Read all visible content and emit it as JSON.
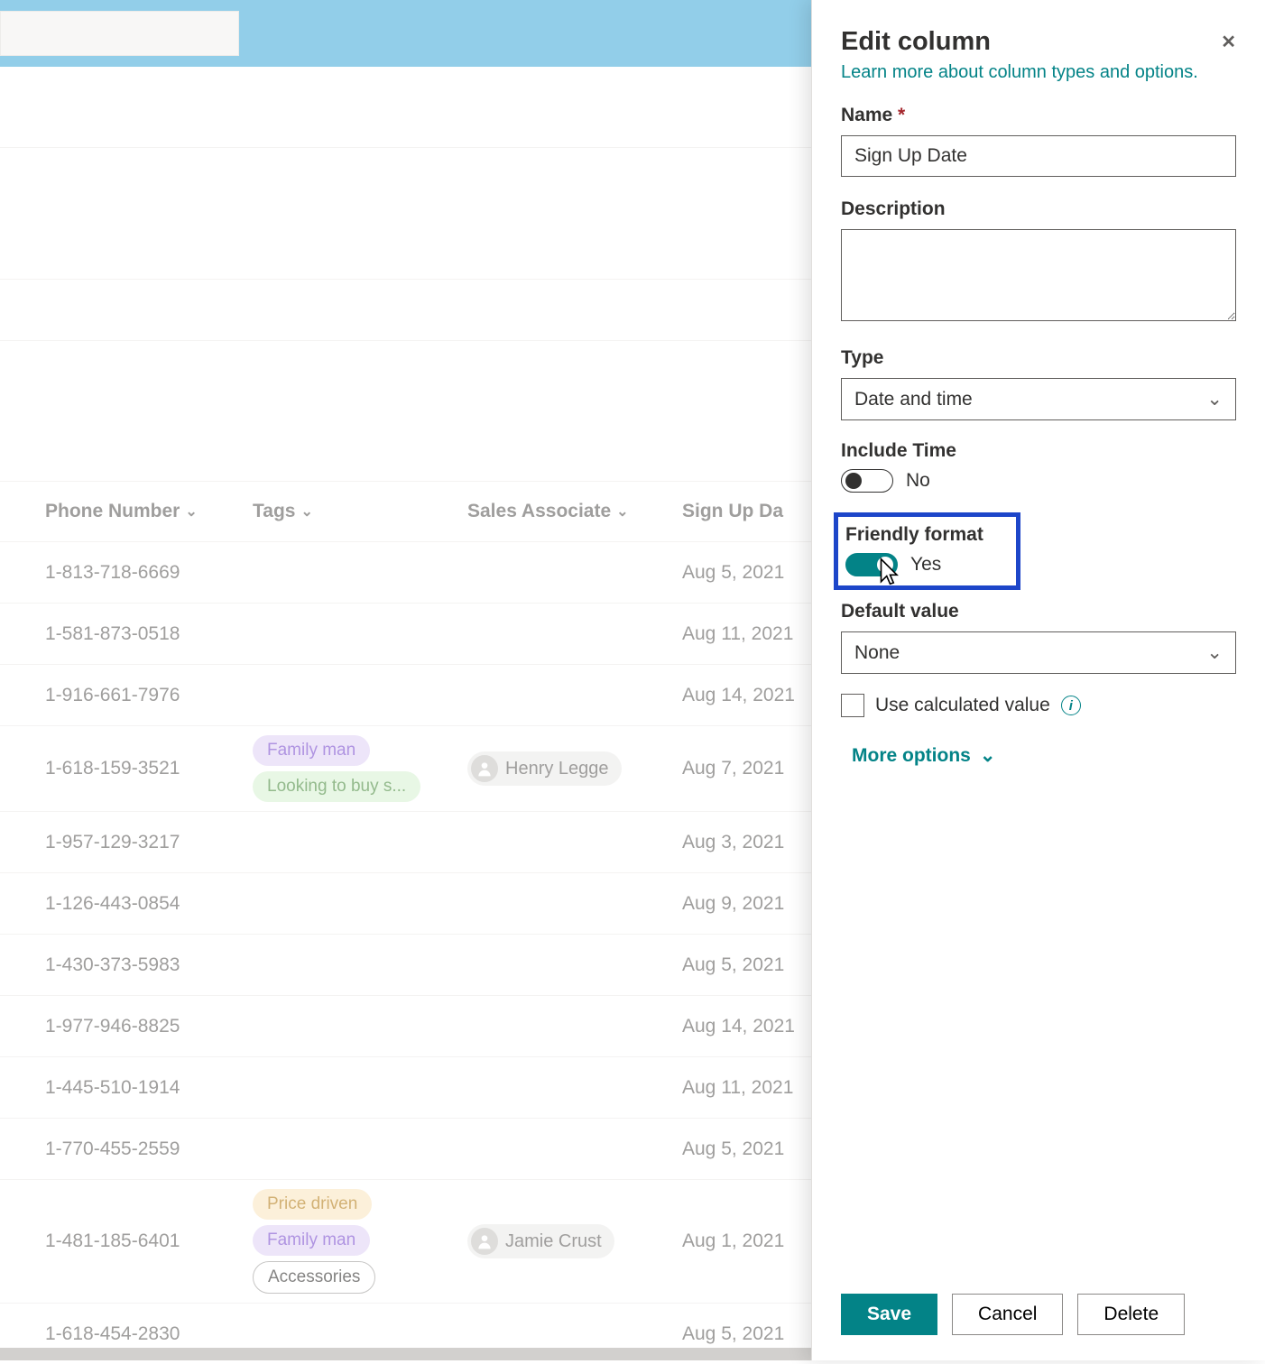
{
  "header": {
    "columns": {
      "phone": "Phone Number",
      "tags": "Tags",
      "sales": "Sales Associate",
      "date": "Sign Up Da"
    }
  },
  "rows": [
    {
      "phone": "1-813-718-6669",
      "tags": [],
      "sales": null,
      "date": "Aug 5, 2021"
    },
    {
      "phone": "1-581-873-0518",
      "tags": [],
      "sales": null,
      "date": "Aug 11, 2021"
    },
    {
      "phone": "1-916-661-7976",
      "tags": [],
      "sales": null,
      "date": "Aug 14, 2021"
    },
    {
      "phone": "1-618-159-3521",
      "tags": [
        {
          "text": "Family man",
          "style": "tag-purple"
        },
        {
          "text": "Looking to buy s...",
          "style": "tag-green"
        }
      ],
      "sales": "Henry Legge",
      "date": "Aug 7, 2021"
    },
    {
      "phone": "1-957-129-3217",
      "tags": [],
      "sales": null,
      "date": "Aug 3, 2021"
    },
    {
      "phone": "1-126-443-0854",
      "tags": [],
      "sales": null,
      "date": "Aug 9, 2021"
    },
    {
      "phone": "1-430-373-5983",
      "tags": [],
      "sales": null,
      "date": "Aug 5, 2021"
    },
    {
      "phone": "1-977-946-8825",
      "tags": [],
      "sales": null,
      "date": "Aug 14, 2021"
    },
    {
      "phone": "1-445-510-1914",
      "tags": [],
      "sales": null,
      "date": "Aug 11, 2021"
    },
    {
      "phone": "1-770-455-2559",
      "tags": [],
      "sales": null,
      "date": "Aug 5, 2021"
    },
    {
      "phone": "1-481-185-6401",
      "tags": [
        {
          "text": "Price driven",
          "style": "tag-orange"
        },
        {
          "text": "Family man",
          "style": "tag-purple"
        },
        {
          "text": "Accessories",
          "style": "tag-outline"
        }
      ],
      "sales": "Jamie Crust",
      "date": "Aug 1, 2021"
    },
    {
      "phone": "1-618-454-2830",
      "tags": [],
      "sales": null,
      "date": "Aug 5, 2021"
    }
  ],
  "panel": {
    "title": "Edit column",
    "learn": "Learn more about column types and options.",
    "name_label": "Name",
    "name_value": "Sign Up Date",
    "desc_label": "Description",
    "desc_value": "",
    "type_label": "Type",
    "type_value": "Date and time",
    "include_time_label": "Include Time",
    "include_time_value": "No",
    "friendly_label": "Friendly format",
    "friendly_value": "Yes",
    "default_label": "Default value",
    "default_value": "None",
    "calc_label": "Use calculated value",
    "more": "More options",
    "save": "Save",
    "cancel": "Cancel",
    "delete": "Delete"
  }
}
